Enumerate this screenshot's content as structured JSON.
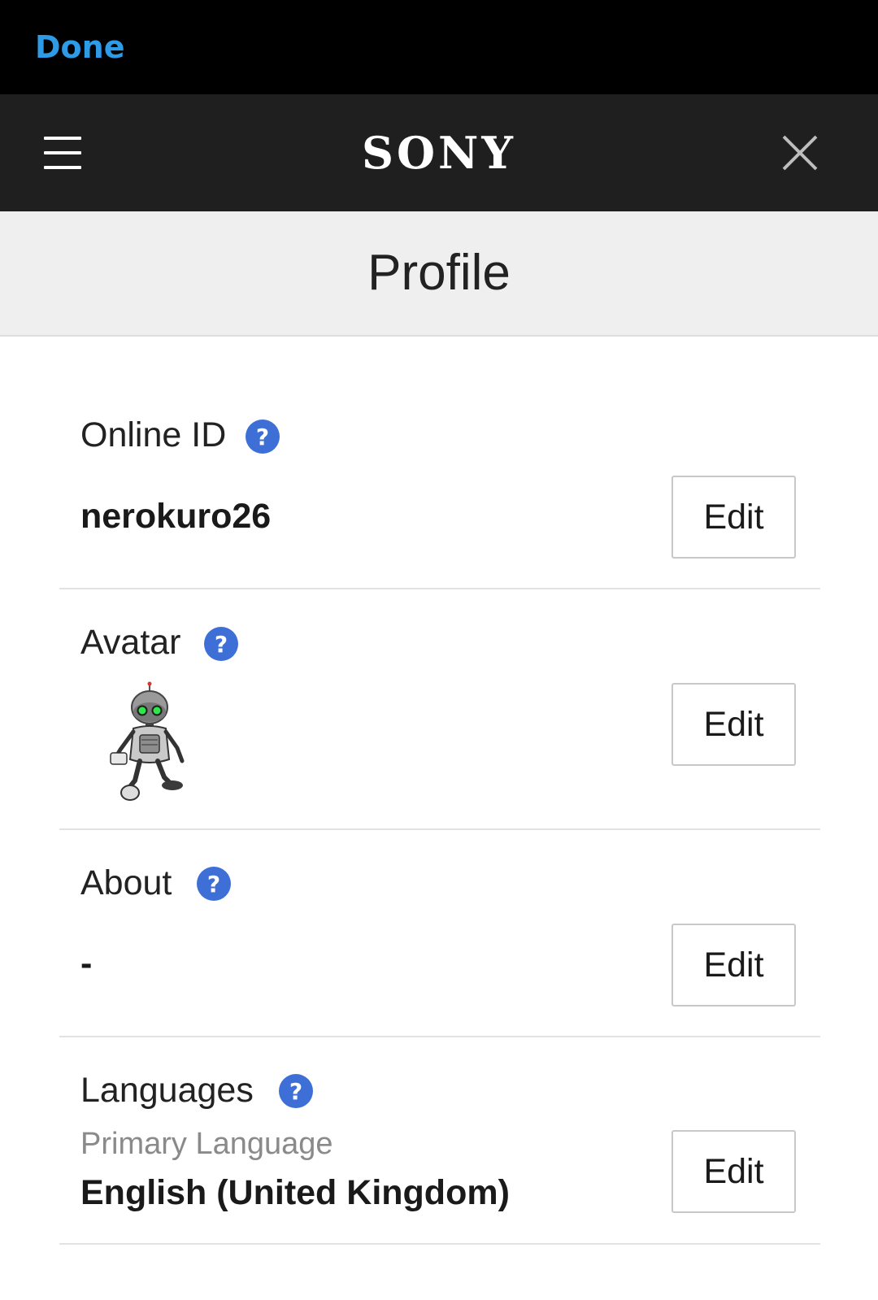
{
  "topbar": {
    "done_label": "Done"
  },
  "header": {
    "brand": "SONY",
    "menu_icon": "hamburger-menu-icon",
    "close_icon": "close-icon"
  },
  "page": {
    "title": "Profile"
  },
  "sections": {
    "online_id": {
      "label": "Online ID",
      "value": "nerokuro26",
      "edit_label": "Edit"
    },
    "avatar": {
      "label": "Avatar",
      "edit_label": "Edit"
    },
    "about": {
      "label": "About",
      "value": "-",
      "edit_label": "Edit"
    },
    "languages": {
      "label": "Languages",
      "primary_label": "Primary Language",
      "value": "English (United Kingdom)",
      "edit_label": "Edit"
    }
  },
  "colors": {
    "accent_done": "#2e9be6",
    "help_icon": "#3d6fd6",
    "header_bg": "#1f1f1f",
    "topbar_bg": "#000000",
    "title_band_bg": "#efefef"
  }
}
